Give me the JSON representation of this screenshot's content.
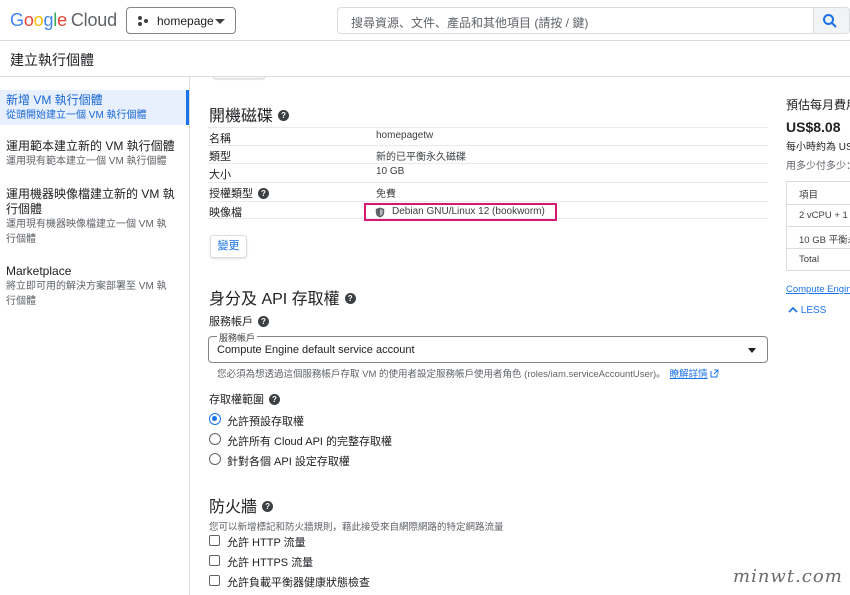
{
  "topbar": {
    "logo_google_letters": [
      "G",
      "o",
      "o",
      "g",
      "l",
      "e"
    ],
    "logo_cloud": "Cloud",
    "project_name": "homepage",
    "search_placeholder": "搜尋資源、文件、產品和其他項目 (請按 / 鍵)"
  },
  "page": {
    "title": "建立執行個體"
  },
  "sidebar": {
    "items": [
      {
        "title": "新增 VM 執行個體",
        "subtitle": "從頭開始建立一個 VM 執行個體",
        "active": true
      },
      {
        "title": "運用範本建立新的 VM 執行個體",
        "subtitle": "運用現有範本建立一個 VM 執行個體",
        "active": false
      },
      {
        "title_line1": "運用機器映像檔建立新的 VM 執",
        "title_line2": "行個體",
        "subtitle_line1": "運用現有機器映像檔建立一個 VM 執",
        "subtitle_line2": "行個體",
        "active": false
      },
      {
        "title": "Marketplace",
        "subtitle_line1": "將立即可用的解決方案部署至 VM 執",
        "subtitle_line2": "行個體",
        "active": false
      }
    ]
  },
  "boot_disk": {
    "title": "開機磁碟",
    "rows": [
      {
        "key": "名稱",
        "value": "homepagetw"
      },
      {
        "key": "類型",
        "value": "新的已平衡永久磁碟"
      },
      {
        "key": "大小",
        "value": "10 GB"
      },
      {
        "key": "授權類型",
        "value": "免費"
      },
      {
        "key": "映像檔",
        "value": "Debian GNU/Linux 12 (bookworm)"
      }
    ],
    "change_label": "變更"
  },
  "identity": {
    "title": "身分及 API 存取權",
    "service_account_label": "服務帳戶",
    "select_floating_label": "服務帳戶",
    "select_value": "Compute Engine default service account",
    "helper_text": "您必須為想透過這個服務帳戶存取 VM 的使用者設定服務帳戶使用者角色 (roles/iam.serviceAccountUser)。",
    "learn_more": "瞭解詳情",
    "scope_label": "存取權範圍",
    "scope_options": [
      {
        "label": "允許預設存取權",
        "selected": true
      },
      {
        "label": "允許所有 Cloud API 的完整存取權",
        "selected": false
      },
      {
        "label": "針對各個 API 設定存取權",
        "selected": false
      }
    ]
  },
  "firewall": {
    "title": "防火牆",
    "description": "您可以新增標記和防火牆規則，藉此接受來自網際網路的特定網路流量",
    "options": [
      {
        "label": "允許 HTTP 流量",
        "checked": false
      },
      {
        "label": "允許 HTTPS 流量",
        "checked": false
      },
      {
        "label": "允許負載平衡器健康狀態檢查",
        "checked": false
      }
    ]
  },
  "estimate": {
    "title": "預估每月費用",
    "price": "US$8.08",
    "hourly": "每小時約為 US",
    "pay_as_you_go": "用多少付多少：",
    "table_rows": [
      "項目",
      "2 vCPU + 1",
      "10 GB 平衡永",
      "Total"
    ],
    "compute_engine_link": "Compute Engine",
    "less_label": "LESS"
  },
  "watermark": "minwt.com",
  "colors": {
    "accent": "#1a73e8",
    "highlight_box": "#d6196e",
    "active_bg": "#e8f0fe"
  }
}
